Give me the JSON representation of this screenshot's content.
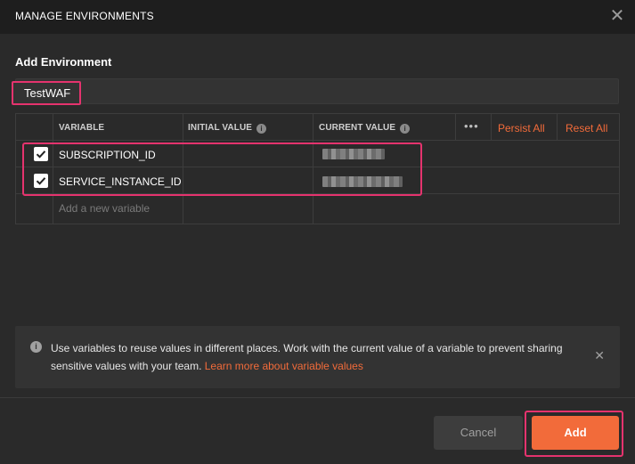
{
  "header": {
    "title": "MANAGE ENVIRONMENTS",
    "close_icon": "close-icon"
  },
  "form": {
    "section_label": "Add Environment",
    "environment_name": "TestWAF"
  },
  "table": {
    "columns": [
      "VARIABLE",
      "INITIAL VALUE",
      "CURRENT VALUE"
    ],
    "bulk_actions": {
      "more_label": "•••",
      "persist_all": "Persist All",
      "reset_all": "Reset All"
    },
    "rows": [
      {
        "checked": true,
        "variable": "SUBSCRIPTION_ID",
        "initial_value": "",
        "current_value_redacted": true
      },
      {
        "checked": true,
        "variable": "SERVICE_INSTANCE_ID",
        "initial_value": "",
        "current_value_redacted": true
      }
    ],
    "new_row_placeholder": "Add a new variable"
  },
  "notice": {
    "text": "Use variables to reuse values in different places. Work with the current value of a variable to prevent sharing sensitive values with your team.",
    "link": "Learn more about variable values"
  },
  "footer": {
    "cancel_label": "Cancel",
    "add_label": "Add"
  },
  "colors": {
    "accent": "#f26b3a",
    "highlight": "#e5336e",
    "background": "#2a2a2a"
  }
}
